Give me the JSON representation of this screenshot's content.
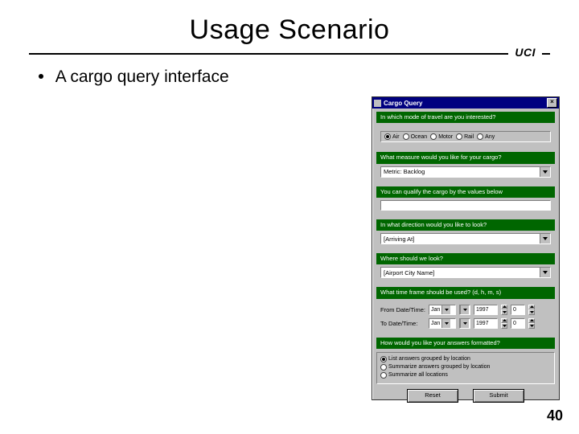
{
  "slide": {
    "title": "Usage Scenario",
    "divider_label": "UCI",
    "bullet": "A cargo query interface",
    "page_number": "40"
  },
  "window": {
    "title": "Cargo Query",
    "close_glyph": "×",
    "q1": {
      "prompt": "In which mode of travel are you interested?",
      "options": [
        "Air",
        "Ocean",
        "Motor",
        "Rail",
        "Any"
      ],
      "selected_index": 0
    },
    "q2": {
      "prompt": "What measure would you like for your cargo?",
      "value": "Metric: Backlog"
    },
    "q3": {
      "prompt": "You can qualify the cargo by the values below"
    },
    "q4": {
      "prompt": "In what direction would you like to look?",
      "value": "[Arriving At]"
    },
    "q5": {
      "prompt": "Where should we look?",
      "value": "[Airport City Name]"
    },
    "q6": {
      "prompt": "What time frame should be used? (d, h, m, s)",
      "from_label": "From Date/Time:",
      "to_label": "To Date/Time:",
      "from_month": "Jan",
      "from_year": "1997",
      "from_extra": "0",
      "to_month": "Jan",
      "to_year": "1997",
      "to_extra": "0"
    },
    "q7": {
      "prompt": "How would you like your answers formatted?",
      "options": [
        "List answers grouped by location",
        "Summarize answers grouped by location",
        "Summarize all locations"
      ],
      "selected_index": 0
    },
    "buttons": {
      "reset": "Reset",
      "submit": "Submit"
    }
  }
}
